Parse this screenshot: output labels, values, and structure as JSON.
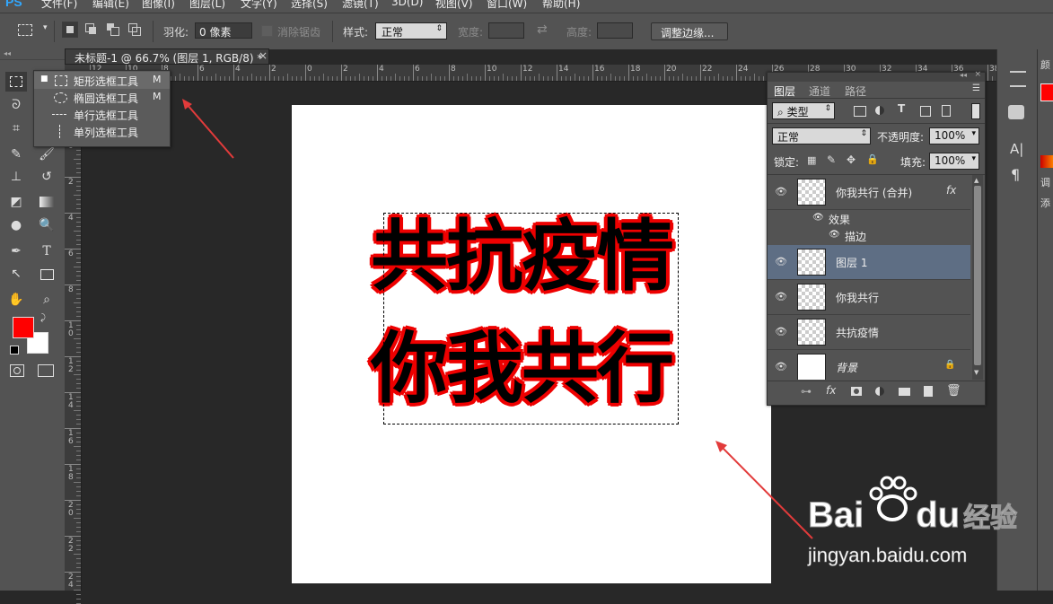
{
  "app": {
    "logo": "PS"
  },
  "menu": [
    "文件(F)",
    "编辑(E)",
    "图像(I)",
    "图层(L)",
    "文字(Y)",
    "选择(S)",
    "滤镜(T)",
    "3D(D)",
    "视图(V)",
    "窗口(W)",
    "帮助(H)"
  ],
  "options": {
    "feather_label": "羽化:",
    "feather_value": "0 像素",
    "antialias_label": "消除锯齿",
    "style_label": "样式:",
    "style_value": "正常",
    "width_label": "宽度:",
    "height_label": "高度:",
    "refine_button": "调整边缘..."
  },
  "document": {
    "tab_title": "未标题-1 @ 66.7% (图层 1, RGB/8) *",
    "close": "×",
    "line1": "共抗疫情",
    "line2": "你我共行",
    "ruler_h_labels": [
      "12",
      "10",
      "8",
      "6",
      "4",
      "2",
      "0",
      "2",
      "4",
      "6",
      "8",
      "10",
      "12",
      "14",
      "16",
      "18",
      "20",
      "22",
      "24",
      "26",
      "28",
      "30",
      "32",
      "34",
      "36",
      "38"
    ],
    "ruler_v_labels": [
      "2",
      "0",
      "2",
      "4",
      "6",
      "8",
      "10",
      "12",
      "14",
      "16",
      "18",
      "20",
      "22",
      "24"
    ]
  },
  "flyout": {
    "items": [
      {
        "label": "矩形选框工具",
        "key": "M"
      },
      {
        "label": "椭圆选框工具",
        "key": "M"
      },
      {
        "label": "单行选框工具",
        "key": ""
      },
      {
        "label": "单列选框工具",
        "key": ""
      }
    ]
  },
  "layers_panel": {
    "tabs": [
      "图层",
      "通道",
      "路径"
    ],
    "filter_kind": "类型",
    "blend_mode": "正常",
    "opacity_label": "不透明度:",
    "opacity_value": "100%",
    "lock_label": "锁定:",
    "fill_label": "填充:",
    "fill_value": "100%",
    "layers": [
      {
        "name": "你我共行 (合并)",
        "fx": "fx",
        "effects_label": "效果",
        "stroke_label": "描边"
      },
      {
        "name": "图层 1"
      },
      {
        "name": "你我共行"
      },
      {
        "name": "共抗疫情"
      },
      {
        "name": "背景"
      }
    ],
    "footer_fx": "fx"
  },
  "dock": {
    "char_icon": "A|",
    "para_icon": "¶",
    "right_label_top": "颜",
    "right_label_adj": "调",
    "right_label_add": "添"
  },
  "watermark": {
    "brand": "Bai",
    "brand2": "du",
    "brand3": "经验",
    "url": "jingyan.baidu.com"
  },
  "colors": {
    "foreground": "#ff0000",
    "background": "#ffffff",
    "stroke": "#e00000",
    "arrow": "#e23b3b",
    "selected_layer": "#5e6e84"
  }
}
